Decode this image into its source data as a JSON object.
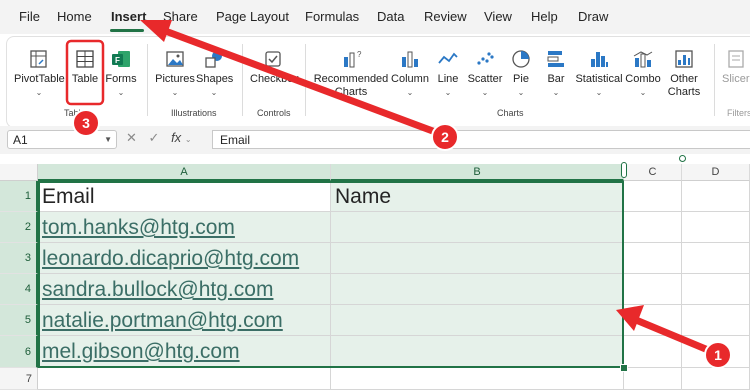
{
  "menu": [
    "File",
    "Home",
    "Insert",
    "Share",
    "Page Layout",
    "Formulas",
    "Data",
    "Review",
    "View",
    "Help",
    "Draw"
  ],
  "active_tab": "Insert",
  "ribbon": {
    "tables": [
      "PivotTable",
      "Table",
      "Forms"
    ],
    "illustrations": [
      "Pictures",
      "Shapes"
    ],
    "controls": [
      "Checkbox"
    ],
    "charts": [
      "Recommended Charts",
      "Column",
      "Line",
      "Scatter",
      "Pie",
      "Bar",
      "Statistical",
      "Combo",
      "Other Charts"
    ],
    "filters": [
      "Slicer"
    ],
    "group_labels": {
      "tables": "Tables",
      "illustrations": "Illustrations",
      "controls": "Controls",
      "charts": "Charts",
      "filters": "Filters"
    }
  },
  "formula_bar": {
    "name_box": "A1",
    "fx": "fx",
    "content": "Email"
  },
  "grid": {
    "columns": [
      "A",
      "B",
      "C",
      "D"
    ],
    "rows": [
      "1",
      "2",
      "3",
      "4",
      "5",
      "6",
      "7"
    ],
    "header_row": {
      "a": "Email",
      "b": "Name"
    },
    "emails": [
      "tom.hanks@htg.com",
      "leonardo.dicaprio@htg.com",
      "sandra.bullock@htg.com",
      "natalie.portman@htg.com",
      "mel.gibson@htg.com"
    ]
  },
  "annotations": [
    "1",
    "2",
    "3"
  ],
  "colors": {
    "accent": "#217346",
    "annotation_red": "#e8292b"
  }
}
